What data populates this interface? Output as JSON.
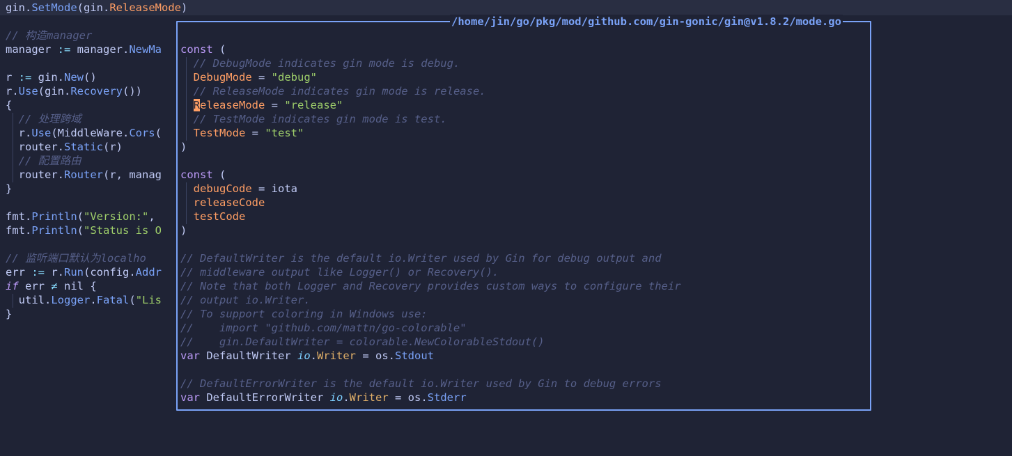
{
  "editor": {
    "lines": [
      [
        [
          "c-pl",
          "gin."
        ],
        [
          "c-fn",
          "SetMode"
        ],
        [
          "c-pl",
          "(gin."
        ],
        [
          "c-const",
          "ReleaseMode"
        ],
        [
          "c-pl",
          ")"
        ]
      ],
      [],
      [
        [
          "c-cmt",
          "// 构造manager"
        ]
      ],
      [
        [
          "c-pl",
          "manager "
        ],
        [
          "c-op",
          ":="
        ],
        [
          "c-pl",
          " manager."
        ],
        [
          "c-fn",
          "NewMa"
        ]
      ],
      [],
      [
        [
          "c-pl",
          "r "
        ],
        [
          "c-op",
          ":="
        ],
        [
          "c-pl",
          " gin."
        ],
        [
          "c-fn",
          "New"
        ],
        [
          "c-pl",
          "()"
        ]
      ],
      [
        [
          "c-pl",
          "r."
        ],
        [
          "c-fn",
          "Use"
        ],
        [
          "c-pl",
          "(gin."
        ],
        [
          "c-fn",
          "Recovery"
        ],
        [
          "c-pl",
          "())"
        ]
      ],
      [
        [
          "c-pl",
          "{"
        ]
      ],
      [
        [
          "c-pl",
          "  "
        ],
        [
          "c-cmt",
          "// 处理跨域"
        ]
      ],
      [
        [
          "c-pl",
          "  r."
        ],
        [
          "c-fn",
          "Use"
        ],
        [
          "c-pl",
          "(MiddleWare."
        ],
        [
          "c-fn",
          "Cors"
        ],
        [
          "c-pl",
          "("
        ]
      ],
      [
        [
          "c-pl",
          "  router."
        ],
        [
          "c-fn",
          "Static"
        ],
        [
          "c-pl",
          "(r)"
        ]
      ],
      [
        [
          "c-pl",
          "  "
        ],
        [
          "c-cmt",
          "// 配置路由"
        ]
      ],
      [
        [
          "c-pl",
          "  router."
        ],
        [
          "c-fn",
          "Router"
        ],
        [
          "c-pl",
          "(r, manag"
        ]
      ],
      [
        [
          "c-pl",
          "}"
        ]
      ],
      [],
      [
        [
          "c-pl",
          "fmt."
        ],
        [
          "c-fn",
          "Println"
        ],
        [
          "c-pl",
          "("
        ],
        [
          "c-str",
          "\"Version:\""
        ],
        [
          "c-pl",
          ", "
        ]
      ],
      [
        [
          "c-pl",
          "fmt."
        ],
        [
          "c-fn",
          "Println"
        ],
        [
          "c-pl",
          "("
        ],
        [
          "c-str",
          "\"Status is O"
        ]
      ],
      [],
      [
        [
          "c-cmt",
          "// 监听端口默认为localho"
        ]
      ],
      [
        [
          "c-pl",
          "err "
        ],
        [
          "c-op",
          ":="
        ],
        [
          "c-pl",
          " r."
        ],
        [
          "c-fn",
          "Run"
        ],
        [
          "c-pl",
          "(config."
        ],
        [
          "c-fn",
          "Addr"
        ]
      ],
      [
        [
          "c-kwi",
          "if"
        ],
        [
          "c-pl",
          " err "
        ],
        [
          "c-op",
          "≠"
        ],
        [
          "c-pl",
          " nil {"
        ]
      ],
      [
        [
          "c-pl",
          "  util."
        ],
        [
          "c-fn",
          "Logger"
        ],
        [
          "c-pl",
          "."
        ],
        [
          "c-fn",
          "Fatal"
        ],
        [
          "c-pl",
          "("
        ],
        [
          "c-str",
          "\"Lis"
        ]
      ],
      [
        [
          "c-pl",
          "}"
        ]
      ]
    ]
  },
  "popup": {
    "title": "/home/jin/go/pkg/mod/github.com/gin-gonic/gin@v1.8.2/mode.go",
    "lines": [
      [],
      [
        [
          "c-kw",
          "const"
        ],
        [
          "c-pl",
          " ("
        ]
      ],
      [
        [
          "c-pl",
          "  "
        ],
        [
          "c-cmt",
          "// DebugMode indicates gin mode is debug."
        ]
      ],
      [
        [
          "c-pl",
          "  "
        ],
        [
          "c-const",
          "DebugMode"
        ],
        [
          "c-pl",
          " = "
        ],
        [
          "c-str",
          "\"debug\""
        ]
      ],
      [
        [
          "c-pl",
          "  "
        ],
        [
          "c-cmt",
          "// ReleaseMode indicates gin mode is release."
        ]
      ],
      [
        [
          "c-pl",
          "  "
        ],
        [
          "cursor",
          "R"
        ],
        [
          "c-const",
          "eleaseMode"
        ],
        [
          "c-pl",
          " = "
        ],
        [
          "c-str",
          "\"release\""
        ]
      ],
      [
        [
          "c-pl",
          "  "
        ],
        [
          "c-cmt",
          "// TestMode indicates gin mode is test."
        ]
      ],
      [
        [
          "c-pl",
          "  "
        ],
        [
          "c-const",
          "TestMode"
        ],
        [
          "c-pl",
          " = "
        ],
        [
          "c-str",
          "\"test\""
        ]
      ],
      [
        [
          "c-pl",
          ")"
        ]
      ],
      [],
      [
        [
          "c-kw",
          "const"
        ],
        [
          "c-pl",
          " ("
        ]
      ],
      [
        [
          "c-pl",
          "  "
        ],
        [
          "c-const",
          "debugCode"
        ],
        [
          "c-pl",
          " = "
        ],
        [
          "c-num",
          "iota"
        ]
      ],
      [
        [
          "c-pl",
          "  "
        ],
        [
          "c-const",
          "releaseCode"
        ]
      ],
      [
        [
          "c-pl",
          "  "
        ],
        [
          "c-const",
          "testCode"
        ]
      ],
      [
        [
          "c-pl",
          ")"
        ]
      ],
      [],
      [
        [
          "c-cmt",
          "// DefaultWriter is the default io.Writer used by Gin for debug output and"
        ]
      ],
      [
        [
          "c-cmt",
          "// middleware output like Logger() or Recovery()."
        ]
      ],
      [
        [
          "c-cmt",
          "// Note that both Logger and Recovery provides custom ways to configure their"
        ]
      ],
      [
        [
          "c-cmt",
          "// output io.Writer."
        ]
      ],
      [
        [
          "c-cmt",
          "// To support coloring in Windows use:"
        ]
      ],
      [
        [
          "c-cmt",
          "//    import \"github.com/mattn/go-colorable\""
        ]
      ],
      [
        [
          "c-cmt",
          "//    gin.DefaultWriter = colorable.NewColorableStdout()"
        ]
      ],
      [
        [
          "c-kw",
          "var"
        ],
        [
          "c-pl",
          " DefaultWriter "
        ],
        [
          "c-pkg",
          "io"
        ],
        [
          "c-pl",
          "."
        ],
        [
          "c-ty",
          "Writer"
        ],
        [
          "c-pl",
          " = os."
        ],
        [
          "c-fn",
          "Stdout"
        ]
      ],
      [],
      [
        [
          "c-cmt",
          "// DefaultErrorWriter is the default io.Writer used by Gin to debug errors"
        ]
      ],
      [
        [
          "c-kw",
          "var"
        ],
        [
          "c-pl",
          " DefaultErrorWriter "
        ],
        [
          "c-pkg",
          "io"
        ],
        [
          "c-pl",
          "."
        ],
        [
          "c-ty",
          "Writer"
        ],
        [
          "c-pl",
          " = os."
        ],
        [
          "c-fn",
          "Stderr"
        ]
      ]
    ]
  },
  "colors": {
    "background": "#1f2335",
    "cursorline": "#292e42",
    "border": "#7aa2f7",
    "keyword": "#bb9af7",
    "function": "#7aa2f7",
    "string": "#9ece6a",
    "comment": "#565f89",
    "constant": "#ff9e64",
    "type": "#e0af68"
  }
}
